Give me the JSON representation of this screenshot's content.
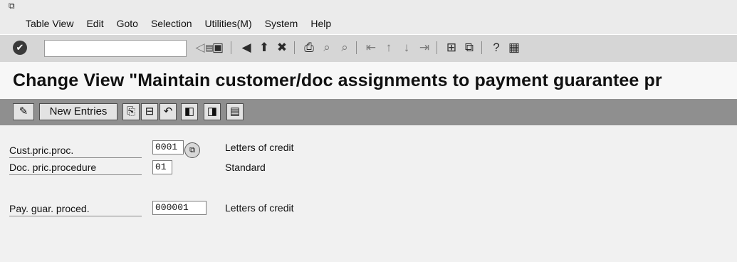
{
  "menu": {
    "system_menu_icon": "system-menu-icon",
    "items": [
      "Table View",
      "Edit",
      "Goto",
      "Selection",
      "Utilities(M)",
      "System",
      "Help"
    ]
  },
  "toolbar": {
    "command_field_value": "",
    "icons": [
      "enter-icon",
      "dropdown-icon",
      "back-icon",
      "save-icon",
      "back-green-icon",
      "exit-icon",
      "cancel-icon",
      "print-icon",
      "find-icon",
      "find-next-icon",
      "first-page-icon",
      "previous-page-icon",
      "next-page-icon",
      "last-page-icon",
      "create-session-icon",
      "shortcut-icon",
      "help-icon",
      "layout-menu-icon"
    ]
  },
  "title": "Change View \"Maintain customer/doc assignments to payment guarantee pr",
  "app_toolbar": {
    "new_entries_label": "New Entries"
  },
  "fields": [
    {
      "label": "Cust.pric.proc.",
      "value": "0001",
      "description": "Letters of credit"
    },
    {
      "label": "Doc. pric.procedure",
      "value": "01",
      "description": "Standard"
    },
    {
      "label": "Pay. guar. proced.",
      "value": "000001",
      "description": "Letters of credit"
    }
  ]
}
